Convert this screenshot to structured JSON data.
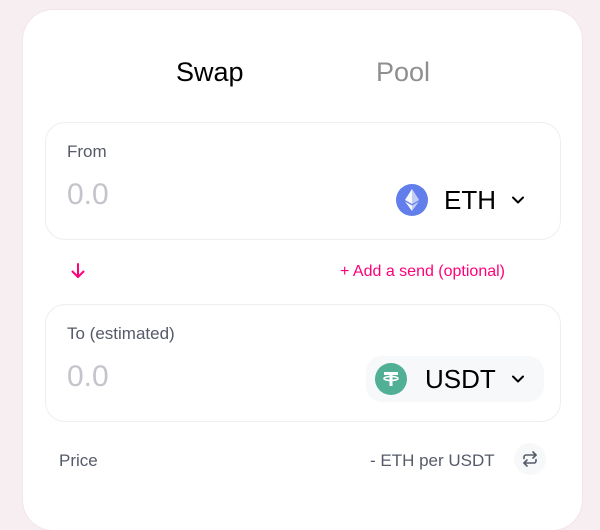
{
  "tabs": [
    {
      "label": "Swap",
      "active": true
    },
    {
      "label": "Pool",
      "active": false
    }
  ],
  "from": {
    "label": "From",
    "amount_placeholder": "0.0",
    "token": {
      "symbol": "ETH",
      "icon": "ethereum-icon"
    }
  },
  "middle": {
    "arrow_icon": "arrow-down-icon",
    "add_send_label": "+ Add a send (optional)"
  },
  "to": {
    "label": "To (estimated)",
    "amount_placeholder": "0.0",
    "token": {
      "symbol": "USDT",
      "icon": "tether-icon"
    }
  },
  "price": {
    "label": "Price",
    "value": "- ETH per USDT",
    "toggle_icon": "swap-arrows-icon"
  },
  "colors": {
    "accent": "#ff007a",
    "eth": "#627eea",
    "usdt": "#50af95",
    "muted_text": "#565a69",
    "placeholder": "#c3c5cb"
  }
}
